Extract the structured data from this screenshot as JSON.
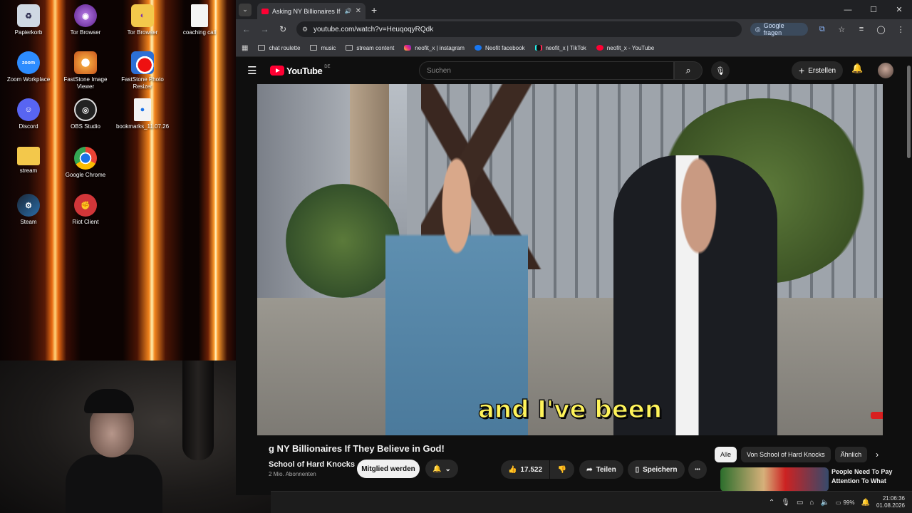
{
  "desktop": {
    "icons": [
      {
        "label": "Papierkorb"
      },
      {
        "label": "Tor Browser"
      },
      {
        "label": "Tor Browser"
      },
      {
        "label": "coaching call"
      },
      {
        "label": "Zoom Workplace"
      },
      {
        "label": "FastStone Image Viewer"
      },
      {
        "label": "FastStone Photo Resizer"
      },
      {
        "label": "Discord"
      },
      {
        "label": "OBS Studio"
      },
      {
        "label": "bookmarks_11.07.26"
      },
      {
        "label": "stream"
      },
      {
        "label": "Google Chrome"
      },
      {
        "label": "Steam"
      },
      {
        "label": "Riot Client"
      }
    ]
  },
  "browser": {
    "tab": {
      "title": "Asking NY Billionaires If The",
      "close": "✕"
    },
    "newtab": "+",
    "window_controls": {
      "minimize": "—",
      "maximize": "☐",
      "close": "✕"
    },
    "url": "youtube.com/watch?v=HeuqoqyRQdk",
    "google_ask": "Google fragen",
    "bookmarks": [
      {
        "label": "chat roulette",
        "icon": "folder"
      },
      {
        "label": "music",
        "icon": "folder"
      },
      {
        "label": "stream content",
        "icon": "folder"
      },
      {
        "label": "neofit_x | instagram",
        "icon": "instagram"
      },
      {
        "label": "Neofit facebook",
        "icon": "facebook"
      },
      {
        "label": "neofit_x | TikTok",
        "icon": "tiktok"
      },
      {
        "label": "neofit_x - YouTube",
        "icon": "youtube"
      }
    ]
  },
  "youtube": {
    "logo_word": "YouTube",
    "logo_region": "DE",
    "search_placeholder": "Suchen",
    "create_label": "Erstellen",
    "caption": "and I've been",
    "video_title": "g NY Billionaires If They Believe in God!",
    "channel_name": "School of Hard Knocks",
    "subscribers": "2 Mio. Abonnenten",
    "member_label": "Mitglied werden",
    "likes": "17.522",
    "share_label": "Teilen",
    "save_label": "Speichern",
    "more_label": "•••",
    "chips": [
      "Alle",
      "Von School of Hard Knocks",
      "Ähnlich"
    ],
    "rec_title": "People Need To Pay Attention To What"
  },
  "taskbar": {
    "battery": "99%",
    "time": "21:06:36",
    "date": "01.08.2026"
  },
  "colors": {
    "youtube_red": "#ff0033",
    "caption_yellow": "#fff45a"
  }
}
